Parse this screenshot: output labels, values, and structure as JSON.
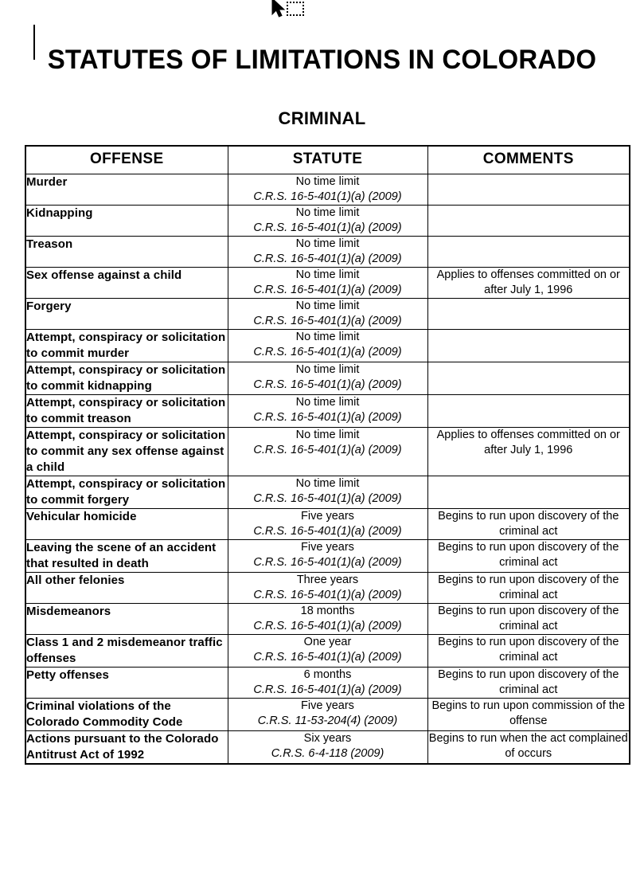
{
  "document": {
    "title": "STATUTES OF LIMITATIONS IN COLORADO",
    "subtitle": "CRIMINAL"
  },
  "cursor": {
    "pointer_icon": "mouse-pointer-arrow-icon",
    "drag_icon": "dotted-selection-square-icon",
    "text_caret": "text-insertion-caret"
  },
  "table": {
    "columns": [
      "OFFENSE",
      "STATUTE",
      "COMMENTS"
    ],
    "rows": [
      {
        "offense": "Murder",
        "term": "No time limit",
        "citation": "C.R.S. 16-5-401(1)(a) (2009)",
        "comment": ""
      },
      {
        "offense": "Kidnapping",
        "term": "No time limit",
        "citation": "C.R.S. 16-5-401(1)(a) (2009)",
        "comment": ""
      },
      {
        "offense": "Treason",
        "term": "No time limit",
        "citation": "C.R.S. 16-5-401(1)(a) (2009)",
        "comment": ""
      },
      {
        "offense": "Sex offense against a child",
        "term": "No time limit",
        "citation": "C.R.S. 16-5-401(1)(a) (2009)",
        "comment": "Applies to offenses committed on or after July 1, 1996"
      },
      {
        "offense": "Forgery",
        "term": "No time limit",
        "citation": "C.R.S. 16-5-401(1)(a) (2009)",
        "comment": ""
      },
      {
        "offense": "Attempt, conspiracy or solicitation to commit murder",
        "term": "No time limit",
        "citation": "C.R.S. 16-5-401(1)(a) (2009)",
        "comment": ""
      },
      {
        "offense": "Attempt, conspiracy or solicitation to commit kidnapping",
        "term": "No time limit",
        "citation": "C.R.S. 16-5-401(1)(a) (2009)",
        "comment": ""
      },
      {
        "offense": "Attempt, conspiracy or solicitation to commit treason",
        "term": "No time limit",
        "citation": "C.R.S. 16-5-401(1)(a) (2009)",
        "comment": ""
      },
      {
        "offense": "Attempt, conspiracy or solicitation to commit any sex offense against a child",
        "term": "No time limit",
        "citation": "C.R.S. 16-5-401(1)(a) (2009)",
        "comment": "Applies to offenses committed on or after July 1, 1996"
      },
      {
        "offense": "Attempt, conspiracy or solicitation to commit forgery",
        "term": "No time limit",
        "citation": "C.R.S. 16-5-401(1)(a) (2009)",
        "comment": ""
      },
      {
        "offense": "Vehicular homicide",
        "term": "Five years",
        "citation": "C.R.S. 16-5-401(1)(a) (2009)",
        "comment": "Begins to run upon discovery of the criminal act"
      },
      {
        "offense": "Leaving the scene of an accident that resulted in death",
        "term": "Five years",
        "citation": "C.R.S. 16-5-401(1)(a) (2009)",
        "comment": "Begins to run upon discovery of the criminal act"
      },
      {
        "offense": "All other felonies",
        "term": "Three years",
        "citation": "C.R.S. 16-5-401(1)(a) (2009)",
        "comment": "Begins to run upon discovery of the criminal act"
      },
      {
        "offense": "Misdemeanors",
        "term": "18 months",
        "citation": "C.R.S. 16-5-401(1)(a) (2009)",
        "comment": "Begins to run upon discovery of the criminal act"
      },
      {
        "offense": "Class 1 and 2 misdemeanor traffic offenses",
        "term": "One year",
        "citation": "C.R.S. 16-5-401(1)(a) (2009)",
        "comment": "Begins to run upon discovery of the criminal act"
      },
      {
        "offense": "Petty offenses",
        "term": "6 months",
        "citation": "C.R.S. 16-5-401(1)(a) (2009)",
        "comment": "Begins to run upon discovery of the criminal act"
      },
      {
        "offense": "Criminal violations of the Colorado Commodity Code",
        "term": "Five years",
        "citation": "C.R.S. 11-53-204(4) (2009)",
        "comment": "Begins to run upon commission of the offense"
      },
      {
        "offense": "Actions pursuant to the Colorado Antitrust Act of 1992",
        "term": "Six years",
        "citation": "C.R.S. 6-4-118 (2009)",
        "comment": "Begins to run when the act complained of occurs"
      }
    ]
  }
}
